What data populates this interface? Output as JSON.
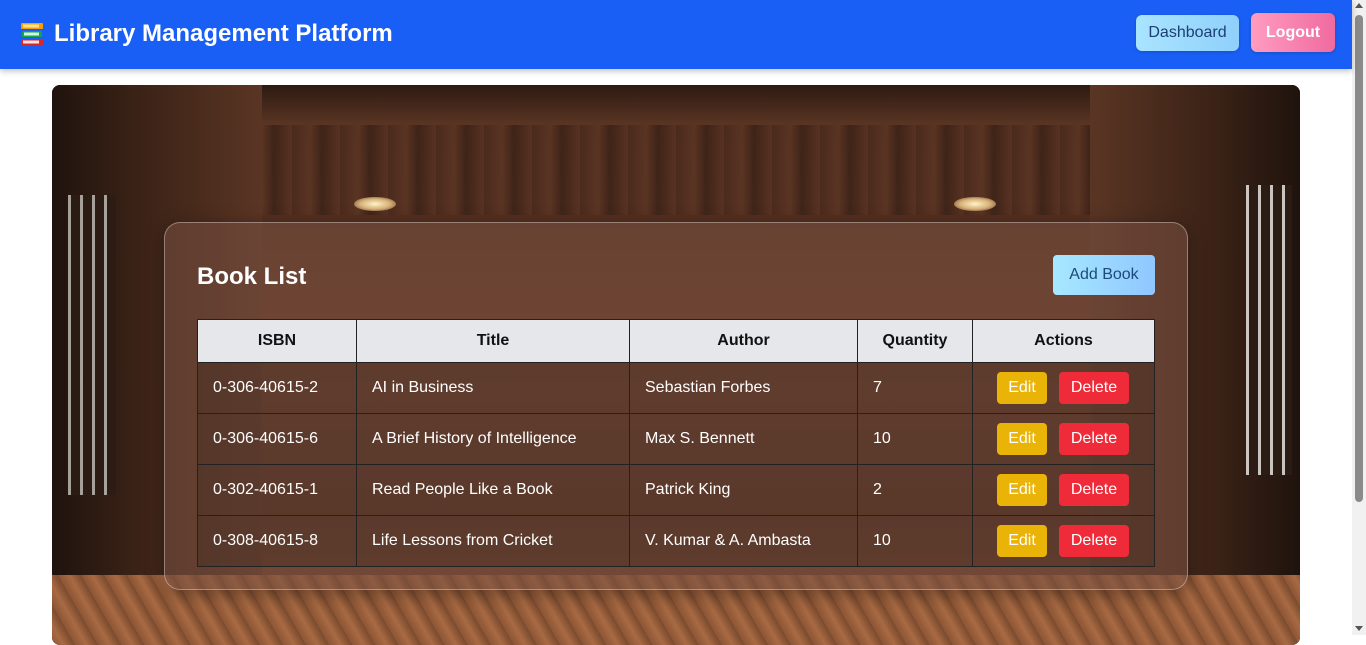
{
  "header": {
    "title": "Library Management Platform",
    "brand_icon": "books-icon",
    "dashboard_label": "Dashboard",
    "logout_label": "Logout",
    "color": "#1a5ff5"
  },
  "book_list": {
    "title": "Book List",
    "add_label": "Add Book",
    "columns": [
      "ISBN",
      "Title",
      "Author",
      "Quantity",
      "Actions"
    ],
    "rows": [
      {
        "isbn": "0-306-40615-2",
        "title": "AI in Business",
        "author": "Sebastian Forbes",
        "quantity": "7"
      },
      {
        "isbn": "0-306-40615-6",
        "title": "A Brief History of Intelligence",
        "author": "Max S. Bennett",
        "quantity": "10"
      },
      {
        "isbn": "0-302-40615-1",
        "title": "Read People Like a Book",
        "author": "Patrick King",
        "quantity": "2"
      },
      {
        "isbn": "0-308-40615-8",
        "title": "Life Lessons from Cricket",
        "author": "V. Kumar & A. Ambasta",
        "quantity": "10"
      }
    ],
    "edit_label": "Edit",
    "delete_label": "Delete",
    "edit_color": "#eab308",
    "delete_color": "#ef2b39"
  }
}
